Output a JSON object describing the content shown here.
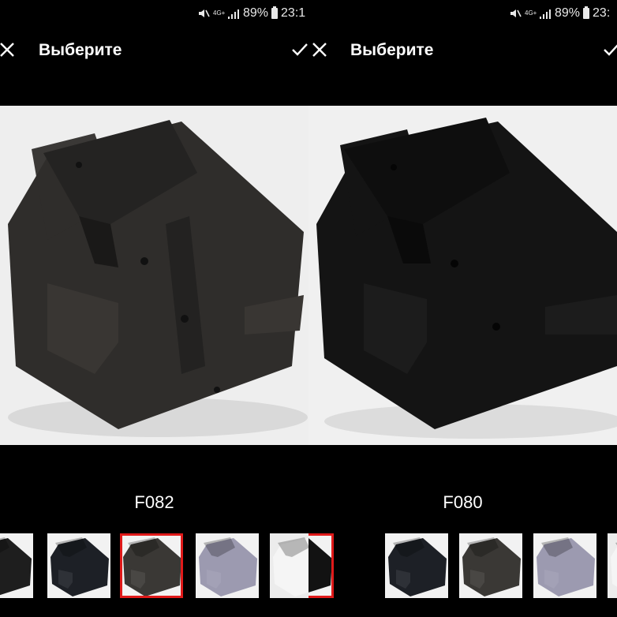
{
  "status": {
    "battery": "89%",
    "network": "4G+",
    "time_left": "23:1",
    "time_right": "23:"
  },
  "panels": [
    {
      "id": "left",
      "title": "Выберите",
      "selected_color_label": "F082",
      "shirt_color": "#2f2d2b",
      "thumbnails": [
        {
          "color": "#1e1e1e",
          "bg": "#f2f2f2",
          "selected": false
        },
        {
          "color": "#1d2026",
          "bg": "#f2f2f2",
          "selected": false
        },
        {
          "color": "#3a3835",
          "bg": "#f2f2f2",
          "selected": true
        },
        {
          "color": "#9c9ab0",
          "bg": "#f2f2f2",
          "selected": false
        },
        {
          "color": "#f5f5f5",
          "bg": "#ececec",
          "selected": false
        }
      ]
    },
    {
      "id": "right",
      "title": "Выберите",
      "selected_color_label": "F080",
      "shirt_color": "#141414",
      "thumbnails": [
        {
          "color": "#121212",
          "bg": "#f2f2f2",
          "selected": true
        },
        {
          "color": "#1d2026",
          "bg": "#f2f2f2",
          "selected": false
        },
        {
          "color": "#3a3835",
          "bg": "#f2f2f2",
          "selected": false
        },
        {
          "color": "#9c9ab0",
          "bg": "#f2f2f2",
          "selected": false
        },
        {
          "color": "#f5f5f5",
          "bg": "#ececec",
          "selected": false
        }
      ]
    }
  ]
}
